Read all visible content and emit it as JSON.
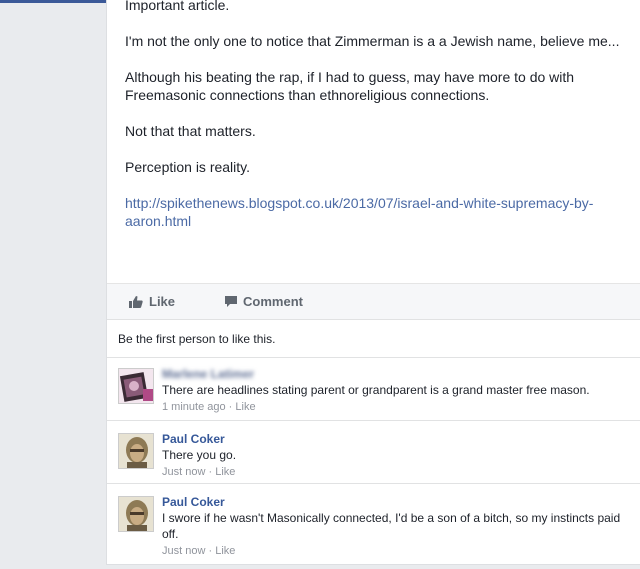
{
  "post": {
    "paragraphs": [
      "Important article.",
      "I'm not the only one to notice that Zimmerman is a a Jewish name, believe me...",
      "Although his beating the rap, if I had to guess, may have more to do with Freemasonic connections than ethnoreligious connections.",
      "Not that that matters.",
      "Perception is reality."
    ],
    "link": "http://spikethenews.blogspot.co.uk/2013/07/israel-and-white-supremacy-by-aaron.html"
  },
  "actions": {
    "like_label": "Like",
    "comment_label": "Comment"
  },
  "likes_summary": "Be the first person to like this.",
  "comments": [
    {
      "author": "Marlene Latimer",
      "text": "There are headlines stating parent or grandparent is a grand master free mason.",
      "time": "1 minute ago",
      "like": "Like"
    },
    {
      "author": "Paul Coker",
      "text": "There you go.",
      "time": "Just now",
      "like": "Like"
    },
    {
      "author": "Paul Coker",
      "text": "I swore if he wasn't Masonically connected, I'd be a son of a bitch, so my instincts paid off.",
      "time": "Just now",
      "like": "Like"
    }
  ],
  "separator": " · ",
  "colors": {
    "link": "#4b6aa5",
    "author": "#365899",
    "meta": "#90949c",
    "background": "#e9ebee"
  }
}
